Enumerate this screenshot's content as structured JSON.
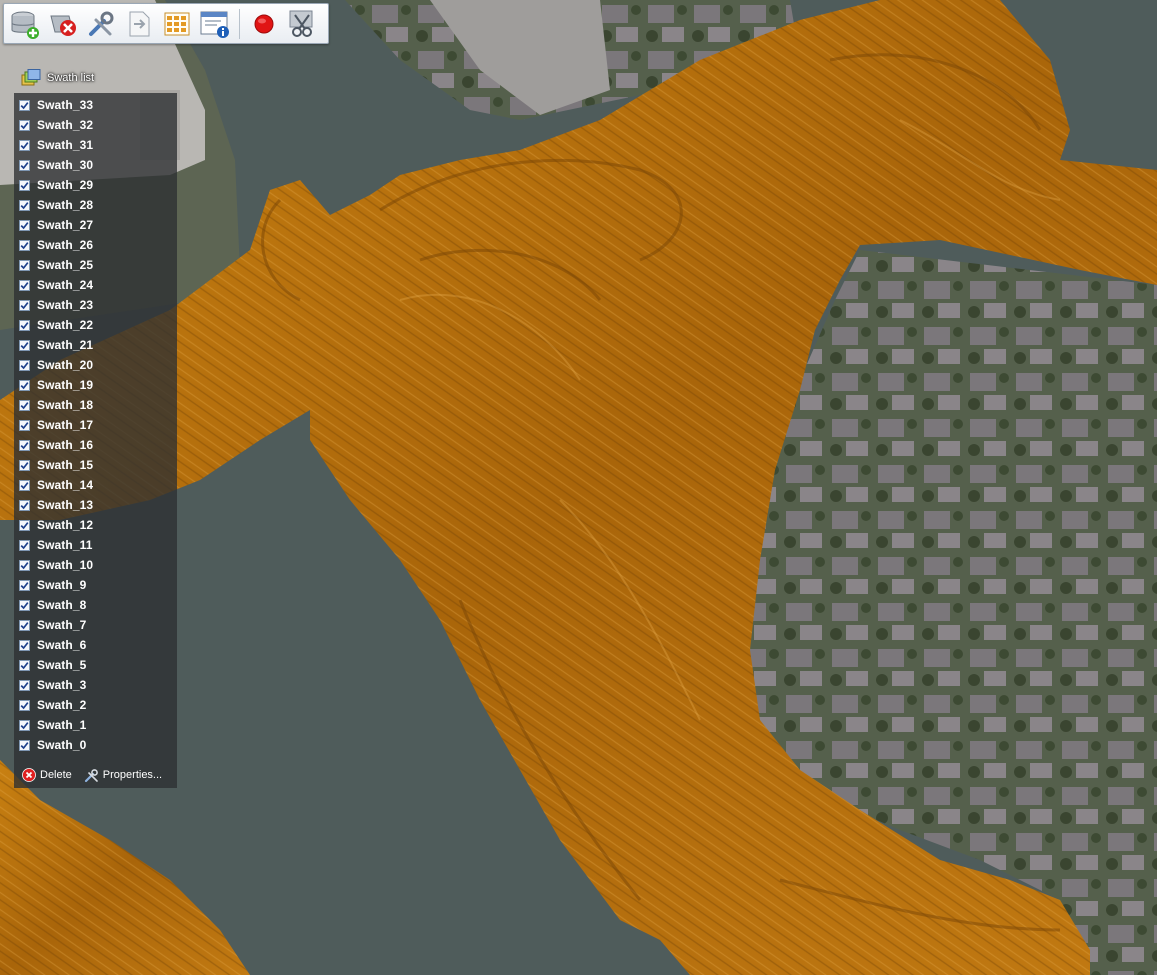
{
  "toolbar": {
    "buttons": [
      {
        "name": "add-layer-button",
        "icon": "database-add-icon"
      },
      {
        "name": "remove-layer-button",
        "icon": "remove-icon"
      },
      {
        "name": "tools-button",
        "icon": "tools-icon"
      },
      {
        "name": "export-button",
        "icon": "export-arrow-icon"
      },
      {
        "name": "grid-view-button",
        "icon": "grid-icon"
      },
      {
        "name": "info-button",
        "icon": "info-window-icon"
      },
      {
        "name": "record-button",
        "icon": "record-icon"
      },
      {
        "name": "cut-tool-button",
        "icon": "scissors-icon"
      }
    ]
  },
  "swath_panel": {
    "title": "Swath list",
    "items": [
      {
        "label": "Swath_33",
        "checked": true
      },
      {
        "label": "Swath_32",
        "checked": true
      },
      {
        "label": "Swath_31",
        "checked": true
      },
      {
        "label": "Swath_30",
        "checked": true
      },
      {
        "label": "Swath_29",
        "checked": true
      },
      {
        "label": "Swath_28",
        "checked": true
      },
      {
        "label": "Swath_27",
        "checked": true
      },
      {
        "label": "Swath_26",
        "checked": true
      },
      {
        "label": "Swath_25",
        "checked": true
      },
      {
        "label": "Swath_24",
        "checked": true
      },
      {
        "label": "Swath_23",
        "checked": true
      },
      {
        "label": "Swath_22",
        "checked": true
      },
      {
        "label": "Swath_21",
        "checked": true
      },
      {
        "label": "Swath_20",
        "checked": true
      },
      {
        "label": "Swath_19",
        "checked": true
      },
      {
        "label": "Swath_18",
        "checked": true
      },
      {
        "label": "Swath_17",
        "checked": true
      },
      {
        "label": "Swath_16",
        "checked": true
      },
      {
        "label": "Swath_15",
        "checked": true
      },
      {
        "label": "Swath_14",
        "checked": true
      },
      {
        "label": "Swath_13",
        "checked": true
      },
      {
        "label": "Swath_12",
        "checked": true
      },
      {
        "label": "Swath_11",
        "checked": true
      },
      {
        "label": "Swath_10",
        "checked": true
      },
      {
        "label": "Swath_9",
        "checked": true
      },
      {
        "label": "Swath_8",
        "checked": true
      },
      {
        "label": "Swath_7",
        "checked": true
      },
      {
        "label": "Swath_6",
        "checked": true
      },
      {
        "label": "Swath_5",
        "checked": true
      },
      {
        "label": "Swath_3",
        "checked": true
      },
      {
        "label": "Swath_2",
        "checked": true
      },
      {
        "label": "Swath_1",
        "checked": true
      },
      {
        "label": "Swath_0",
        "checked": true
      }
    ],
    "delete_label": "Delete",
    "properties_label": "Properties..."
  },
  "colors": {
    "water": "#4f5c5b",
    "sonar_amber": "#b8720a",
    "sonar_highlight": "#e0a43a",
    "land": "#5c6153",
    "roof": "#7c787c",
    "panel_bg": "#2d3032"
  }
}
